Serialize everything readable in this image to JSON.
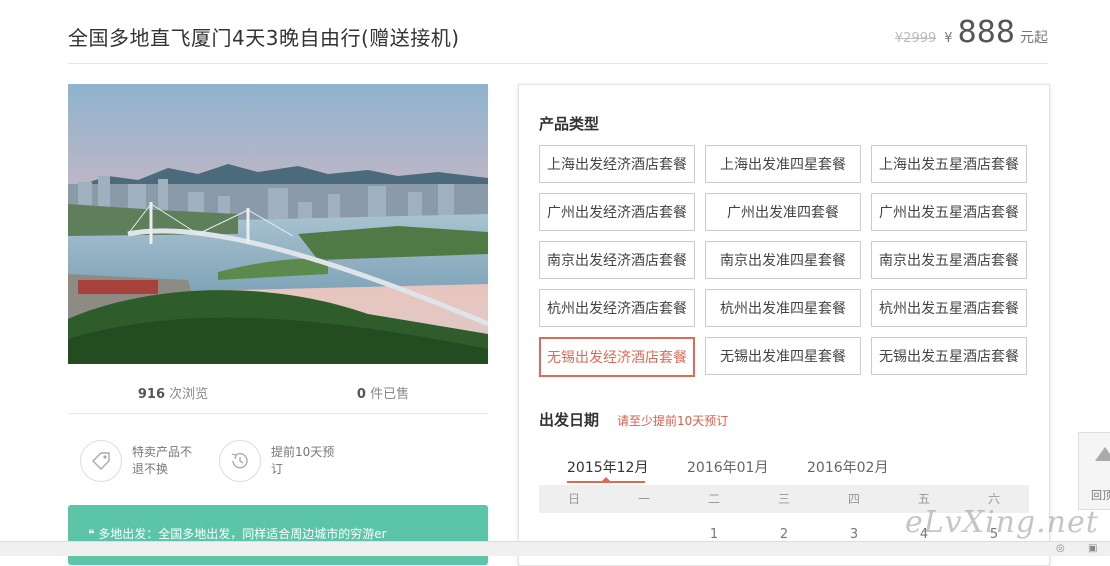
{
  "header": {
    "title": "全国多地直飞厦门4天3晚自由行(赠送接机)",
    "original_price": "¥2999",
    "currency": "¥",
    "price": "888",
    "price_unit": "元起"
  },
  "stats": {
    "views_count": "916",
    "views_label": " 次浏览",
    "sold_count": "0",
    "sold_label": " 件已售"
  },
  "features": [
    {
      "icon": "tag-icon",
      "text": "特卖产品不退不换"
    },
    {
      "icon": "clock-history-icon",
      "text": "提前10天预订"
    }
  ],
  "notice": {
    "text": "❝ 多地出发：全国多地出发，同样适合周边城市的穷游er"
  },
  "panel": {
    "product_type_label": "产品类型",
    "packages": [
      {
        "label": "上海出发经济酒店套餐",
        "selected": false
      },
      {
        "label": "上海出发准四星套餐",
        "selected": false
      },
      {
        "label": "上海出发五星酒店套餐",
        "selected": false
      },
      {
        "label": "广州出发经济酒店套餐",
        "selected": false
      },
      {
        "label": "广州出发准四套餐",
        "selected": false
      },
      {
        "label": "广州出发五星酒店套餐",
        "selected": false
      },
      {
        "label": "南京出发经济酒店套餐",
        "selected": false
      },
      {
        "label": "南京出发准四星套餐",
        "selected": false
      },
      {
        "label": "南京出发五星酒店套餐",
        "selected": false
      },
      {
        "label": "杭州出发经济酒店套餐",
        "selected": false
      },
      {
        "label": "杭州出发准四星套餐",
        "selected": false
      },
      {
        "label": "杭州出发五星酒店套餐",
        "selected": false
      },
      {
        "label": "无锡出发经济酒店套餐",
        "selected": true
      },
      {
        "label": "无锡出发准四星套餐",
        "selected": false
      },
      {
        "label": "无锡出发五星酒店套餐",
        "selected": false
      }
    ],
    "departure_label": "出发日期",
    "departure_hint": "请至少提前10天预订",
    "months": [
      "2015年12月",
      "2016年01月",
      "2016年02月"
    ],
    "active_month": "2015年12月",
    "weekdays": [
      "日",
      "一",
      "二",
      "三",
      "四",
      "五",
      "六"
    ],
    "first_week_days": [
      "",
      "",
      "1",
      "2",
      "3",
      "4",
      "5"
    ]
  },
  "side_tab": {
    "label": "回顶"
  },
  "watermark": "eLvXing.net",
  "colors": {
    "accent": "#e06a55",
    "notice_bg": "#5cc5a8"
  }
}
